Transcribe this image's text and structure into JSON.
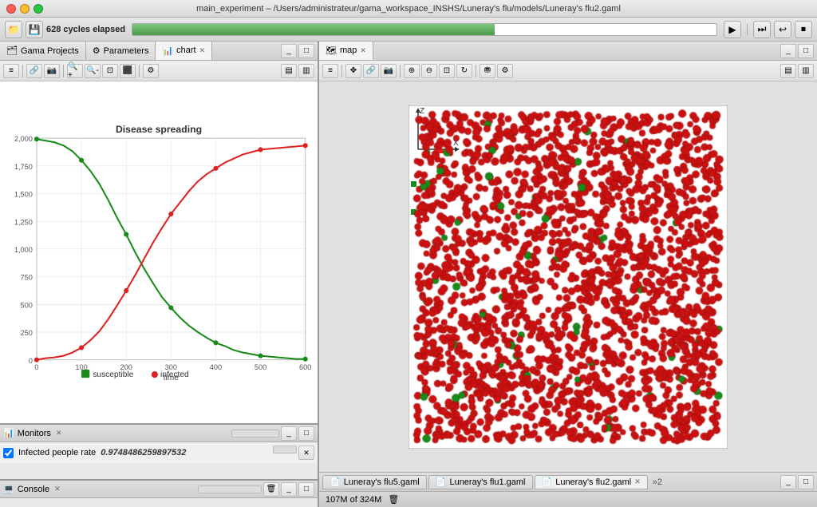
{
  "window": {
    "title": "main_experiment – /Users/administrateur/gama_workspace_INSHS/Luneray's flu/models/Luneray's flu2.gaml",
    "cycles_label": "628 cycles elapsed"
  },
  "toolbar": {
    "play_btn": "▶",
    "pause_btn": "⏸",
    "stop_btn": "⏹",
    "rewind_btn": "↩"
  },
  "left_panel": {
    "tabs": [
      {
        "label": "Gama Projects",
        "icon": "🗂"
      },
      {
        "label": "Parameters",
        "icon": "⚙"
      },
      {
        "label": "chart",
        "icon": "📊",
        "active": true,
        "closeable": true
      }
    ],
    "chart": {
      "title": "Disease spreading",
      "x_label": "time",
      "y_max": 2100,
      "legend": [
        {
          "color": "#1a8a1a",
          "label": "susceptible"
        },
        {
          "color": "#e02020",
          "label": "infected"
        }
      ],
      "x_ticks": [
        "0",
        "100",
        "200",
        "300",
        "400",
        "500",
        "600"
      ],
      "y_ticks": [
        "0",
        "250",
        "500",
        "750",
        "1,000",
        "1,250",
        "1,500",
        "1,750",
        "2,000"
      ]
    }
  },
  "monitor": {
    "tab_label": "Monitors",
    "row": {
      "checkbox": true,
      "label": "Infected people rate",
      "value": "0.9748486259897532"
    }
  },
  "console": {
    "tab_label": "Console"
  },
  "right_panel": {
    "tab_label": "map",
    "axis": {
      "z": "Z",
      "x": "X"
    }
  },
  "bottom_tabs": [
    {
      "label": "Luneray's flu5.gaml",
      "active": false
    },
    {
      "label": "Luneray's flu1.gaml",
      "active": false
    },
    {
      "label": "Luneray's flu2.gaml",
      "active": true
    }
  ],
  "status_bar": {
    "memory": "107M of 324M"
  }
}
